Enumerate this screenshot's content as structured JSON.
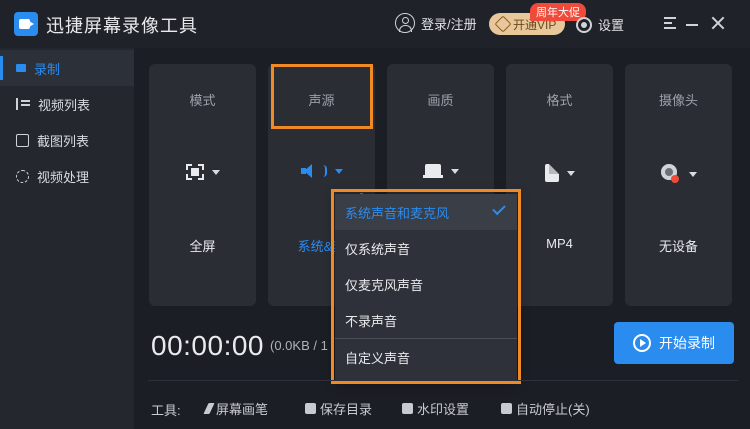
{
  "app": {
    "title": "迅捷屏幕录像工具"
  },
  "header": {
    "login_label": "登录/注册",
    "vip_label": "开通VIP",
    "promo_badge": "周年大促",
    "settings_label": "设置"
  },
  "sidebar": {
    "items": [
      {
        "label": "录制",
        "icon": "record-icon",
        "active": true
      },
      {
        "label": "视频列表",
        "icon": "list-icon"
      },
      {
        "label": "截图列表",
        "icon": "screenshot-icon"
      },
      {
        "label": "视频处理",
        "icon": "video-process-icon"
      }
    ]
  },
  "cards": [
    {
      "label": "模式",
      "value": "全屏",
      "icon": "fullscreen-icon"
    },
    {
      "label": "声源",
      "value": "系统&麦",
      "icon": "speaker-icon"
    },
    {
      "label": "画质",
      "value": "",
      "icon": "laptop-icon"
    },
    {
      "label": "格式",
      "value": "MP4",
      "icon": "file-icon"
    },
    {
      "label": "摄像头",
      "value": "无设备",
      "icon": "camera-icon"
    }
  ],
  "dropdown": {
    "options": [
      "系统声音和麦克风",
      "仅系统声音",
      "仅麦克风声音",
      "不录声音",
      "自定义声音"
    ],
    "selected": "系统声音和麦克风"
  },
  "recorder": {
    "timer": "00:00:00",
    "size": "(0.0KB / 1",
    "start_label": "开始录制"
  },
  "tools": {
    "label": "工具:",
    "items": [
      "屏幕画笔",
      "保存目录",
      "水印设置",
      "自动停止(关)"
    ]
  },
  "colors": {
    "accent": "#2b8cf0",
    "highlight": "#f08a24",
    "background": "#1b1e24"
  }
}
